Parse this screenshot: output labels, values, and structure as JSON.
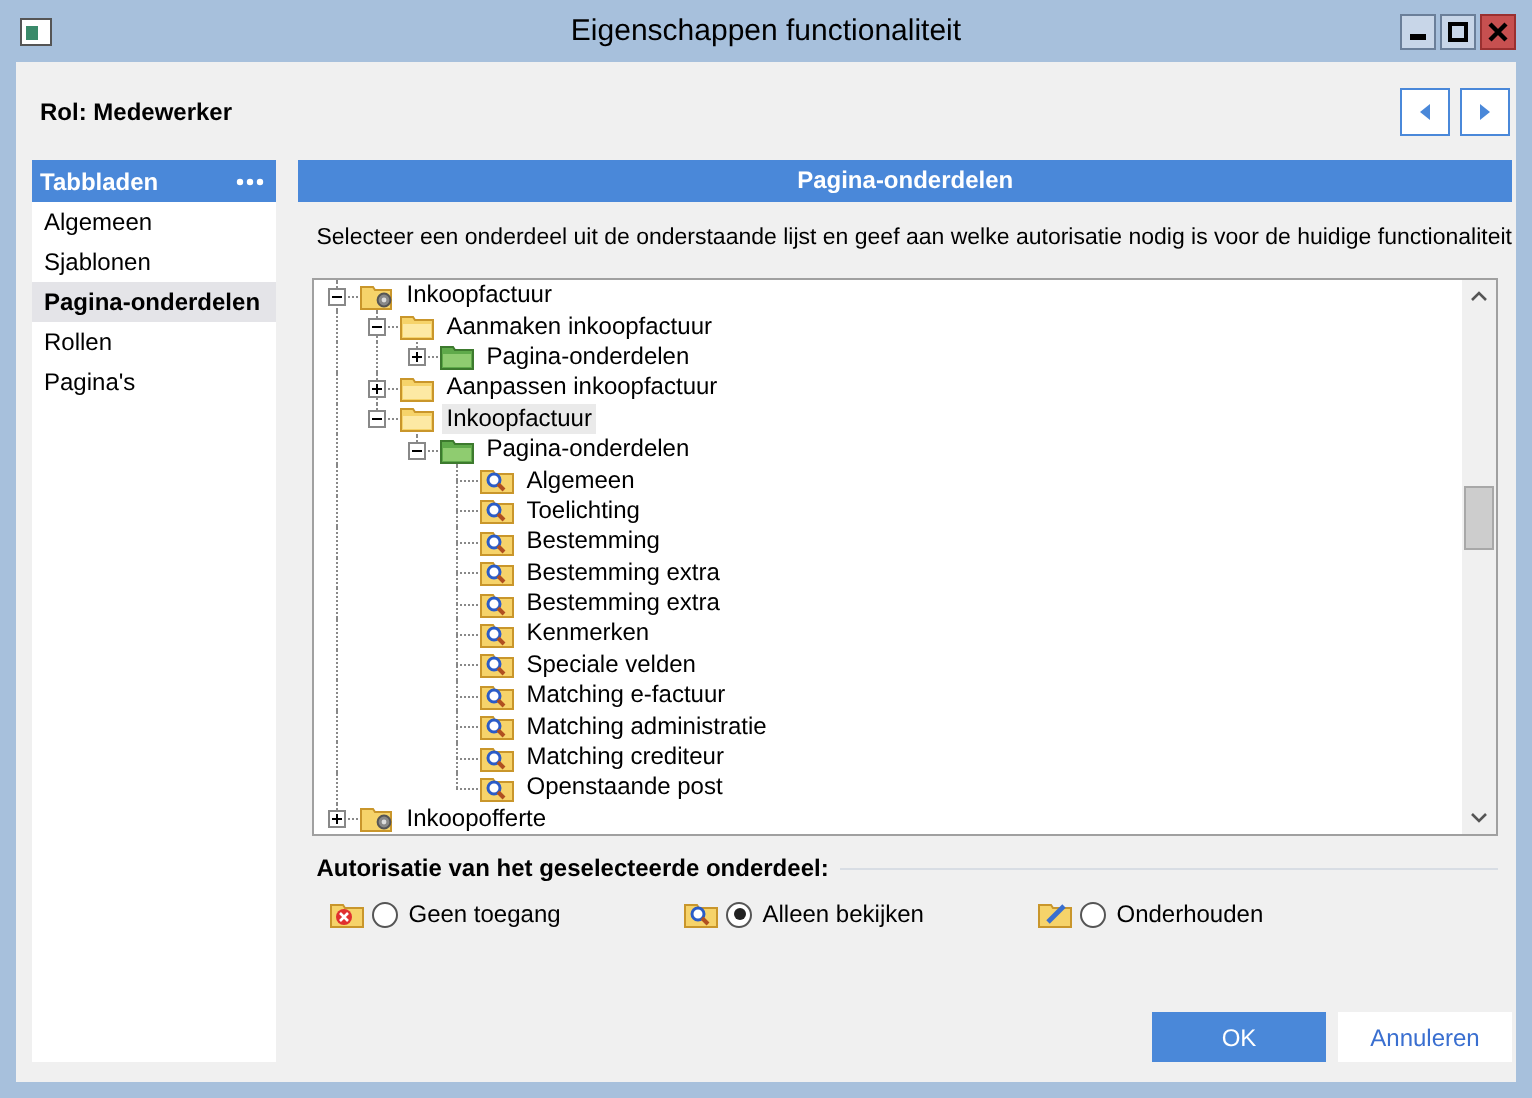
{
  "window": {
    "title": "Eigenschappen functionaliteit"
  },
  "role": "Rol: Medewerker",
  "sidebar": {
    "title": "Tabbladen",
    "items": [
      {
        "label": "Algemeen",
        "selected": false
      },
      {
        "label": "Sjablonen",
        "selected": false
      },
      {
        "label": "Pagina-onderdelen",
        "selected": true
      },
      {
        "label": "Rollen",
        "selected": false
      },
      {
        "label": "Pagina's",
        "selected": false
      }
    ]
  },
  "panel": {
    "title": "Pagina-onderdelen",
    "instruction": "Selecteer een onderdeel uit de onderstaande lijst en geef aan welke autorisatie nodig is voor de huidige functionaliteit"
  },
  "tree": {
    "items": [
      {
        "label": "Inkoopfactuur",
        "kind": "gear",
        "expanded": true,
        "selected": false,
        "children": [
          {
            "label": "Aanmaken inkoopfactuur",
            "kind": "folder",
            "expanded": true,
            "selected": false,
            "children": [
              {
                "label": "Pagina-onderdelen",
                "kind": "green",
                "expanded": false,
                "selected": false,
                "has_children": true
              }
            ]
          },
          {
            "label": "Aanpassen inkoopfactuur",
            "kind": "folder",
            "expanded": false,
            "selected": false,
            "has_children": true
          },
          {
            "label": "Inkoopfactuur",
            "kind": "folder",
            "expanded": true,
            "selected": true,
            "children": [
              {
                "label": "Pagina-onderdelen",
                "kind": "green",
                "expanded": true,
                "selected": false,
                "children": [
                  {
                    "label": "Algemeen",
                    "kind": "view",
                    "selected": false
                  },
                  {
                    "label": "Toelichting",
                    "kind": "view",
                    "selected": false
                  },
                  {
                    "label": "Bestemming",
                    "kind": "view",
                    "selected": false
                  },
                  {
                    "label": "Bestemming extra",
                    "kind": "view",
                    "selected": false
                  },
                  {
                    "label": "Bestemming extra",
                    "kind": "view",
                    "selected": false
                  },
                  {
                    "label": "Kenmerken",
                    "kind": "view",
                    "selected": false
                  },
                  {
                    "label": "Speciale velden",
                    "kind": "view",
                    "selected": false
                  },
                  {
                    "label": "Matching e-factuur",
                    "kind": "view",
                    "selected": false
                  },
                  {
                    "label": "Matching administratie",
                    "kind": "view",
                    "selected": false
                  },
                  {
                    "label": "Matching crediteur",
                    "kind": "view",
                    "selected": false
                  },
                  {
                    "label": "Openstaande post",
                    "kind": "view",
                    "selected": false
                  }
                ]
              }
            ]
          }
        ]
      },
      {
        "label": "Inkoopofferte",
        "kind": "gear",
        "expanded": false,
        "selected": false,
        "has_children": true
      }
    ]
  },
  "authorization": {
    "title": "Autorisatie van het geselecteerde onderdeel:",
    "options": [
      {
        "label": "Geen toegang",
        "kind": "none",
        "selected": false
      },
      {
        "label": "Alleen bekijken",
        "kind": "view",
        "selected": true
      },
      {
        "label": "Onderhouden",
        "kind": "edit",
        "selected": false
      }
    ]
  },
  "buttons": [
    {
      "label": "OK",
      "kind": "primary"
    },
    {
      "label": "Annuleren",
      "kind": "secondary"
    }
  ]
}
